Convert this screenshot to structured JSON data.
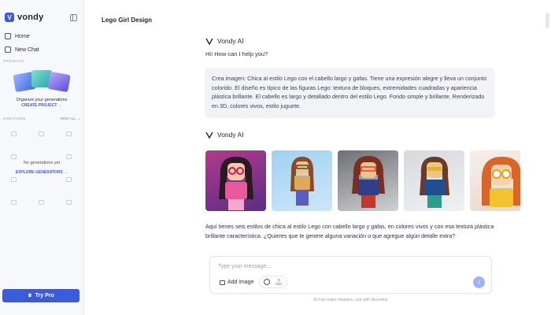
{
  "sidebar": {
    "brand": "vondy",
    "brand_logo": "V",
    "nav": {
      "home": "Home",
      "new_chat": "New Chat"
    },
    "projects_label": "PROJECTS",
    "organize_text": "Organize your generations",
    "create_project": "CREATE PROJECT →",
    "creations_label": "CREATIONS",
    "view_all": "VIEW ALL →",
    "no_generations": "No generations yet",
    "explore_generators": "EXPLORE GENERATORS →",
    "try_pro": "Try Pro"
  },
  "main": {
    "title": "Lego Girl Design",
    "ai_name": "Vondy AI",
    "greeting": "Hi! How can I help you?",
    "user_prompt": "Crea imagen: Chica al estilo Lego con el cabello largo y gafas. Tiene una expresión alegre y lleva un conjunto colorido. El diseño es típico de las figuras Lego: textura de bloques, extremidades cuadradas y apariencia plástica brillante. El cabello es largo y detallado dentro del estilo Lego. Fondo simple y brillante. Renderizado en 3D, colores vivos, estilo juguete.",
    "ai_name_2": "Vondy AI",
    "response": "Aquí tienes seis estilos de chica al estilo Lego con cabello largo y gafas, en colores vivos y con esa textura plástica brillante característica. ¿Quieres que te genere alguna variación o que agregue algún detalle extra?"
  },
  "composer": {
    "placeholder": "Type your message...",
    "add_image": "Add image",
    "pro_badge": "PRO",
    "disclaimer": "AI may make mistakes, use with discretion"
  },
  "colors": {
    "accent": "#3b5bdb",
    "send_button": "#9fb4f5"
  },
  "icons": [
    "home-icon",
    "new-chat-icon",
    "collapse-sidebar-icon",
    "vondy-ai-icon",
    "image-icon",
    "send-icon",
    "crown-icon"
  ]
}
